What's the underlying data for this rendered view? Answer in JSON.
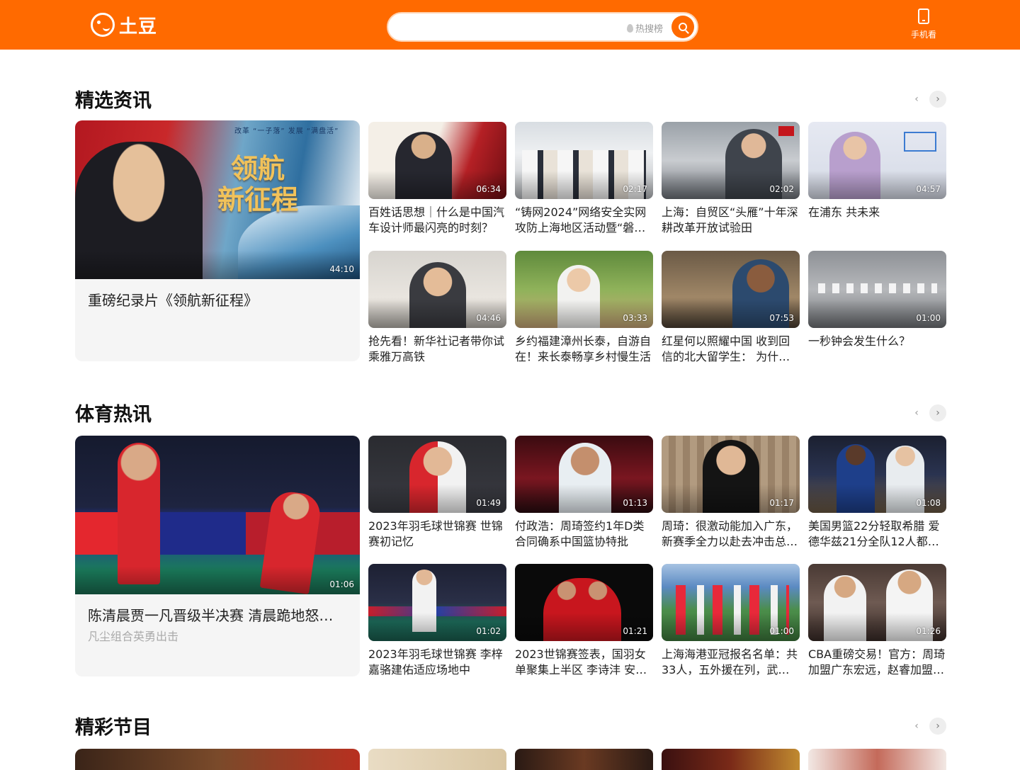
{
  "header": {
    "logo_text": "土豆",
    "search_placeholder": "",
    "hot_label": "热搜榜",
    "mobile_label": "手机看"
  },
  "sections": [
    {
      "title": "精选资讯",
      "featured": {
        "title": "重磅纪录片《领航新征程》",
        "duration": "44:10",
        "overlay_title": "领航\n新征程",
        "overlay_slogan": "改革 “一子落” 发展 “满盘活”"
      },
      "cards": [
        {
          "title": "百姓话思想｜什么是中国汽车设计师最闪亮的时刻？",
          "duration": "06:34"
        },
        {
          "title": "“铸网2024”网络安全实网攻防上海地区活动暨“磐石…",
          "duration": "02:17"
        },
        {
          "title": "上海：自贸区“头雁”十年深耕改革开放试验田",
          "duration": "02:02"
        },
        {
          "title": "在浦东 共未来",
          "duration": "04:57"
        },
        {
          "title": "抢先看！新华社记者带你试乘雅万高铁",
          "duration": "04:46"
        },
        {
          "title": "乡约福建漳州长泰，自游自在！来长泰畅享乡村慢生活",
          "duration": "03:33"
        },
        {
          "title": "红星何以照耀中国  收到回信的北大留学生： 为什…",
          "duration": "07:53"
        },
        {
          "title": "一秒钟会发生什么？",
          "duration": "01:00"
        }
      ]
    },
    {
      "title": "体育热讯",
      "featured": {
        "title": "陈清晨贾一凡晋级半决赛 清晨跪地怒…",
        "subtitle": "凡尘组合英勇出击",
        "meta": "",
        "duration": "01:06"
      },
      "cards": [
        {
          "title": "2023年羽毛球世锦赛 世锦赛初记忆",
          "duration": "01:49"
        },
        {
          "title": "付政浩：周琦签约1年D类合同确系中国篮协特批",
          "duration": "01:13"
        },
        {
          "title": "周琦：很激动能加入广东，新赛季全力以赴去冲击总…",
          "duration": "01:17"
        },
        {
          "title": "美国男篮22分轻取希腊 爱德华兹21分全队12人都…",
          "duration": "01:08"
        },
        {
          "title": "2023年羽毛球世锦赛 李梓嘉骆建佑适应场地中",
          "duration": "01:02"
        },
        {
          "title": "2023世锦赛签表，国羽女单聚集上半区 李诗沣 安…",
          "duration": "01:21"
        },
        {
          "title": "上海海港亚冠报名名单：共33人，五外援在列，武磊…",
          "duration": "01:00"
        },
        {
          "title": "CBA重磅交易！官方：周琦加盟广东宏远，赵睿加盟…",
          "duration": "01:26"
        }
      ]
    },
    {
      "title": "精彩节目"
    }
  ],
  "colors": {
    "brand": "#ff6a00"
  },
  "icons": {
    "search": "search-icon",
    "hot": "flame-icon",
    "mobile": "phone-icon",
    "prev": "chevron-left-icon",
    "next": "chevron-right-icon"
  }
}
